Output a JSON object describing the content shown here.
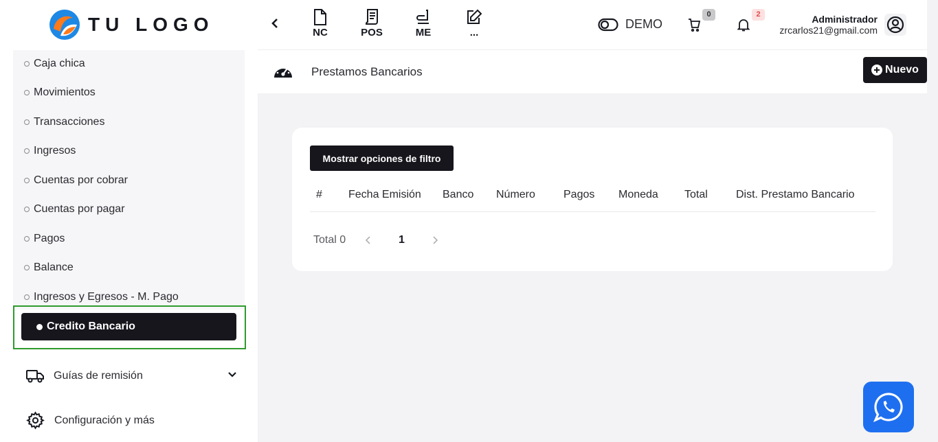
{
  "logo": {
    "text": "TU LOGO"
  },
  "sidebar": {
    "sub_items": [
      "Caja chica",
      "Movimientos",
      "Transacciones",
      "Ingresos",
      "Cuentas por cobrar",
      "Cuentas por pagar",
      "Pagos",
      "Balance",
      "Ingresos y Egresos - M. Pago"
    ],
    "active_item": "Credito Bancario",
    "menu": [
      {
        "label": "Guías de remisión",
        "icon": "truck-icon"
      },
      {
        "label": "Configuración y más",
        "icon": "gear-icon"
      }
    ]
  },
  "header": {
    "quick_links": [
      "NC",
      "POS",
      "ME",
      "..."
    ],
    "demo_label": "DEMO",
    "cart_count": "0",
    "notification_count": "2",
    "user_name": "Administrador",
    "user_email": "zrcarlos21@gmail.com"
  },
  "page": {
    "title": "Prestamos Bancarios",
    "new_button": "Nuevo"
  },
  "table": {
    "filter_button": "Mostrar opciones de filtro",
    "columns": [
      "#",
      "Fecha Emisión",
      "Banco",
      "Número",
      "Pagos",
      "Moneda",
      "Total",
      "Dist. Prestamo Bancario"
    ],
    "total_label": "Total 0",
    "current_page": "1"
  },
  "colors": {
    "accent": "#16161c",
    "whatsapp": "#1e6ff0",
    "highlight": "#2e9a2e"
  }
}
